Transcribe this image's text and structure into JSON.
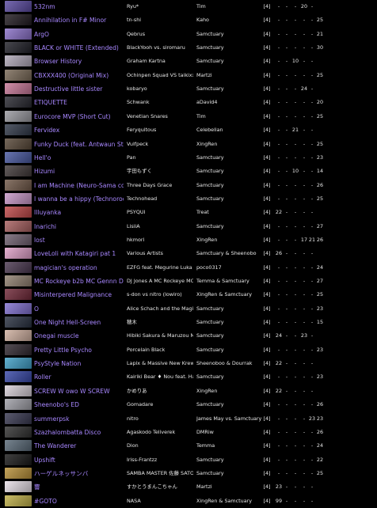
{
  "colors": {
    "background": "#000000",
    "title": "#a887ff",
    "text": "#e8e8e8"
  },
  "rows": [
    {
      "title": "532nm",
      "artist": "Ryu*",
      "charter": "Tim",
      "d": [
        "[4]",
        "-",
        "-",
        "-",
        "20",
        "-",
        ""
      ],
      "thumb": "#5a4aa0"
    },
    {
      "title": "Annihilation in F# Minor",
      "artist": "tn-shi",
      "charter": "Kaho",
      "d": [
        "[4]",
        "-",
        "-",
        "-",
        "-",
        "-",
        "25"
      ],
      "thumb": "#201a20"
    },
    {
      "title": "ArgO",
      "artist": "Qebrus",
      "charter": "Samctuary",
      "d": [
        "[4]",
        "-",
        "-",
        "-",
        "-",
        "-",
        "21"
      ],
      "thumb": "#8a70c8"
    },
    {
      "title": "BLACK or WHITE (Extended)",
      "artist": "BlackYooh vs. siromaru",
      "charter": "Samctuary",
      "d": [
        "[4]",
        "-",
        "-",
        "-",
        "-",
        "-",
        "30"
      ],
      "thumb": "#202028"
    },
    {
      "title": "Browser History",
      "artist": "Graham Kartna",
      "charter": "Samctuary",
      "d": [
        "[4]",
        "-",
        "-",
        "10",
        "-",
        "-",
        ""
      ],
      "thumb": "#b0a8b8"
    },
    {
      "title": "CBXXX400 (Original Mix)",
      "artist": "Ochinpen Squad VS taikixxx",
      "charter": "Martzi",
      "d": [
        "[4]",
        "-",
        "-",
        "-",
        "-",
        "-",
        "25"
      ],
      "thumb": "#7a6a58"
    },
    {
      "title": "Destructive little sister",
      "artist": "kobaryo",
      "charter": "Samctuary",
      "d": [
        "[4]",
        "-",
        "-",
        "-",
        "24",
        "-",
        ""
      ],
      "thumb": "#c87898"
    },
    {
      "title": "ETIQUETTE",
      "artist": "Schwank",
      "charter": "aDavid4",
      "d": [
        "[4]",
        "-",
        "-",
        "-",
        "-",
        "-",
        "20"
      ],
      "thumb": "#282830"
    },
    {
      "title": "Eurocore MVP (Short Cut)",
      "artist": "Venetian Snares",
      "charter": "Tim",
      "d": [
        "[4]",
        "-",
        "-",
        "-",
        "-",
        "-",
        "25"
      ],
      "thumb": "#9a9aa0"
    },
    {
      "title": "Fervidex",
      "artist": "Feryquitous",
      "charter": "Celebelian",
      "d": [
        "[4]",
        "-",
        "-",
        "21",
        "-",
        "-",
        ""
      ],
      "thumb": "#303848"
    },
    {
      "title": "Funky Duck (feat. Antwaun Stanley)",
      "artist": "Vulfpeck",
      "charter": "XingRen",
      "d": [
        "[4]",
        "-",
        "-",
        "-",
        "-",
        "-",
        "25"
      ],
      "thumb": "#584838"
    },
    {
      "title": "Hell'o",
      "artist": "Pan",
      "charter": "Samctuary",
      "d": [
        "[4]",
        "-",
        "-",
        "-",
        "-",
        "-",
        "23"
      ],
      "thumb": "#4858a0"
    },
    {
      "title": "Hizumi",
      "artist": "宇田もずく",
      "charter": "Samctuary",
      "d": [
        "[4]",
        "-",
        "-",
        "10",
        "-",
        "-",
        "14"
      ],
      "thumb": "#403838"
    },
    {
      "title": "I am Machine (Neuro-Sama cover)",
      "artist": "Three Days Grace",
      "charter": "Samctuary",
      "d": [
        "[4]",
        "-",
        "-",
        "-",
        "-",
        "-",
        "26"
      ],
      "thumb": "#705848"
    },
    {
      "title": "I wanna be a hippy (Technoroch Remix)",
      "artist": "Technohead",
      "charter": "Samctuary",
      "d": [
        "[4]",
        "-",
        "-",
        "-",
        "-",
        "-",
        "25"
      ],
      "thumb": "#c898c8"
    },
    {
      "title": "Illuyanka",
      "artist": "PSYQUI",
      "charter": "Treat",
      "d": [
        "[4]",
        "22",
        "-",
        "-",
        "-",
        "-",
        ""
      ],
      "thumb": "#c04848"
    },
    {
      "title": "Inarichi",
      "artist": "LisiiA",
      "charter": "Samctuary",
      "d": [
        "[4]",
        "-",
        "-",
        "-",
        "-",
        "-",
        "27"
      ],
      "thumb": "#a86060"
    },
    {
      "title": "lost",
      "artist": "hkmori",
      "charter": "XingRen",
      "d": [
        "[4]",
        "-",
        "-",
        "-",
        "17",
        "21",
        "26"
      ],
      "thumb": "#706070"
    },
    {
      "title": "LoveLoli with Katagiri pat 1",
      "artist": "Various Artists",
      "charter": "Samctuary & Sheenobo",
      "d": [
        "[4]",
        "26",
        "-",
        "-",
        "-",
        "-",
        ""
      ],
      "thumb": "#e0a0c8"
    },
    {
      "title": "magician's operation",
      "artist": "EZFG feat. Megurine Luka",
      "charter": "poco0317",
      "d": [
        "[4]",
        "-",
        "-",
        "-",
        "-",
        "-",
        "24"
      ],
      "thumb": "#4a3850"
    },
    {
      "title": "MC Rockeye b2b MC Gennn D kiff",
      "artist": "DJ Jones A MC Rockeye MC Gennn D",
      "charter": "Temma & Samctuary",
      "d": [
        "[4]",
        "-",
        "-",
        "-",
        "-",
        "-",
        "27"
      ],
      "thumb": "#908070"
    },
    {
      "title": "Misinterpered Malignance",
      "artist": "s-don vs nitro (lowiro)",
      "charter": "XingRen & Samctuary",
      "d": [
        "[4]",
        "-",
        "-",
        "-",
        "-",
        "-",
        "25"
      ],
      "thumb": "#702838"
    },
    {
      "title": "O",
      "artist": "Alice Schach and the Magic Orchestra",
      "charter": "Samctuary",
      "d": [
        "[4]",
        "-",
        "-",
        "-",
        "-",
        "-",
        "23"
      ],
      "thumb": "#8070d0"
    },
    {
      "title": "One Night Hell-Screen",
      "artist": "穂木",
      "charter": "Samctuary",
      "d": [
        "[4]",
        "-",
        "-",
        "-",
        "-",
        "-",
        "15"
      ],
      "thumb": "#283040"
    },
    {
      "title": "Onegai muscle",
      "artist": "Hibiki Sakura & Maruzou Machio",
      "charter": "Samctuary",
      "d": [
        "[4]",
        "24",
        "-",
        "-",
        "23",
        "-",
        ""
      ],
      "thumb": "#d0b0a0"
    },
    {
      "title": "Pretty Little Psycho",
      "artist": "Porcelain Black",
      "charter": "Samctuary",
      "d": [
        "[4]",
        "-",
        "-",
        "-",
        "-",
        "-",
        "23"
      ],
      "thumb": "#302830"
    },
    {
      "title": "PsyStyle Nation",
      "artist": "Lapix & Massive New Krew",
      "charter": "Sheenoboo & Dourrak",
      "d": [
        "[4]",
        "22",
        "-",
        "-",
        "-",
        "-",
        ""
      ],
      "thumb": "#40a0c8"
    },
    {
      "title": "Roller",
      "artist": "Kairiki Bear ♦ Nou feat. Hatsune Miku",
      "charter": "Samctuary",
      "d": [
        "[4]",
        "-",
        "-",
        "-",
        "-",
        "-",
        "23"
      ],
      "thumb": "#3848a8"
    },
    {
      "title": "SCREW W owo W SCREW",
      "artist": "かめりあ",
      "charter": "XingRen",
      "d": [
        "[4]",
        "22",
        "-",
        "-",
        "-",
        "-",
        ""
      ],
      "thumb": "#d8d0d8"
    },
    {
      "title": "Sheenobo's ED",
      "artist": "Gomadare",
      "charter": "Samctuary",
      "d": [
        "[4]",
        "-",
        "-",
        "-",
        "-",
        "-",
        "26"
      ],
      "thumb": "#a0a0a8"
    },
    {
      "title": "summerpsk",
      "artist": "nitro",
      "charter": "James May vs. Samctuary",
      "d": [
        "[4]",
        "-",
        "-",
        "-",
        "-",
        "23",
        "23"
      ],
      "thumb": "#383850"
    },
    {
      "title": "Szazhalombatta Disco",
      "artist": "Agaskodo Teliverek",
      "charter": "DMRiw",
      "d": [
        "[4]",
        "-",
        "-",
        "-",
        "-",
        "-",
        "26"
      ],
      "thumb": "#303030"
    },
    {
      "title": "The Wanderer",
      "artist": "Dion",
      "charter": "Temma",
      "d": [
        "[4]",
        "-",
        "-",
        "-",
        "-",
        "-",
        "24"
      ],
      "thumb": "#5a6a78"
    },
    {
      "title": "Upshift",
      "artist": "Iriss-Frantzz",
      "charter": "Samctuary",
      "d": [
        "[4]",
        "-",
        "-",
        "-",
        "-",
        "-",
        "22"
      ],
      "thumb": "#181818"
    },
    {
      "title": "ハーゲルネッサンバ",
      "artist": "SAMBA MASTER 佐藤 SATOH",
      "charter": "Samctuary",
      "d": [
        "[4]",
        "-",
        "-",
        "-",
        "-",
        "-",
        "25"
      ],
      "thumb": "#b89038"
    },
    {
      "title": "響",
      "artist": "すかとうまんこちゃん",
      "charter": "Martzi",
      "d": [
        "[4]",
        "23",
        "-",
        "-",
        "-",
        "-",
        ""
      ],
      "thumb": "#e8e0e8"
    },
    {
      "title": "#GOTO",
      "artist": "NASA",
      "charter": "XingRen & Samctuary",
      "d": [
        "[4]",
        "99",
        "-",
        "-",
        "-",
        "-",
        ""
      ],
      "thumb": "#c0b048"
    }
  ]
}
